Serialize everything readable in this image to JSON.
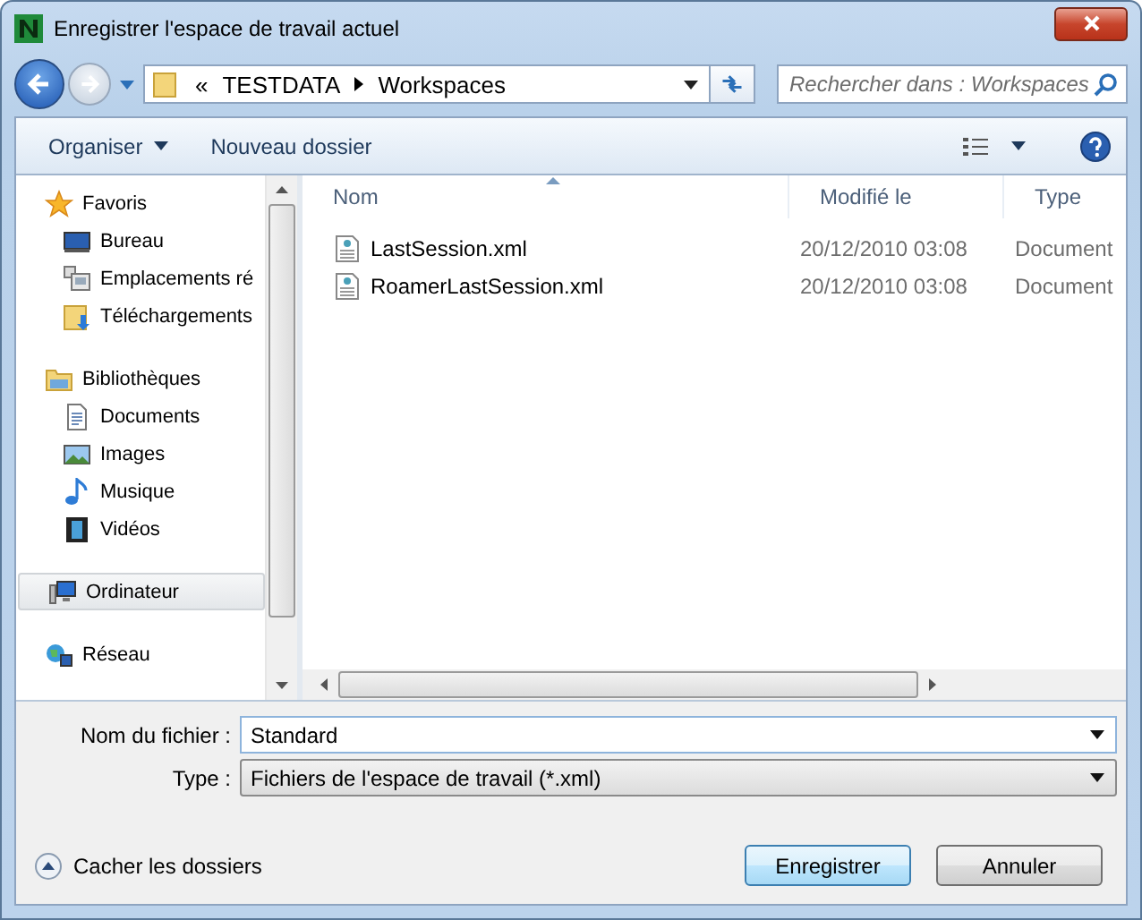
{
  "window": {
    "title": "Enregistrer l'espace de travail actuel"
  },
  "navigation": {
    "back": {
      "disabled": false
    },
    "forward": {
      "disabled": true
    }
  },
  "address": {
    "overflow": "«",
    "breadcrumbs": [
      "TESTDATA",
      "Workspaces"
    ]
  },
  "search": {
    "placeholder": "Rechercher dans : Workspaces"
  },
  "toolbar": {
    "items": [
      {
        "label": "Organiser",
        "dropdown": true
      },
      {
        "label": "Nouveau dossier",
        "dropdown": false
      }
    ]
  },
  "sidebar": {
    "groups": [
      {
        "label": "Favoris",
        "kind": "star",
        "selected": false,
        "children": [
          {
            "label": "Bureau",
            "kind": "desktop",
            "selected": false
          },
          {
            "label": "Emplacements ré",
            "kind": "recent",
            "selected": false
          },
          {
            "label": "Téléchargements",
            "kind": "download",
            "selected": false
          }
        ]
      },
      {
        "label": "Bibliothèques",
        "kind": "library",
        "selected": false,
        "children": [
          {
            "label": "Documents",
            "kind": "document",
            "selected": false
          },
          {
            "label": "Images",
            "kind": "image",
            "selected": false
          },
          {
            "label": "Musique",
            "kind": "music",
            "selected": false
          },
          {
            "label": "Vidéos",
            "kind": "video",
            "selected": false
          }
        ]
      },
      {
        "label": "Ordinateur",
        "kind": "computer",
        "selected": true
      },
      {
        "label": "Réseau",
        "kind": "network",
        "selected": false
      }
    ]
  },
  "file_list": {
    "columns": [
      {
        "label": "Nom",
        "sorted": true
      },
      {
        "label": "Modifié le",
        "sorted": false
      },
      {
        "label": "Type",
        "sorted": false
      }
    ],
    "rows": [
      {
        "name": "LastSession.xml",
        "modified": "20/12/2010 03:08",
        "type": "Document"
      },
      {
        "name": "RoamerLastSession.xml",
        "modified": "20/12/2010 03:08",
        "type": "Document"
      }
    ]
  },
  "filename": {
    "label": "Nom du fichier :",
    "value": "Standard"
  },
  "filetype": {
    "label": "Type :",
    "value": "Fichiers de l'espace de travail (*.xml)"
  },
  "hide_folders": "Cacher les dossiers",
  "buttons": [
    {
      "label": "Enregistrer",
      "default": true
    },
    {
      "label": "Annuler",
      "default": false
    }
  ]
}
